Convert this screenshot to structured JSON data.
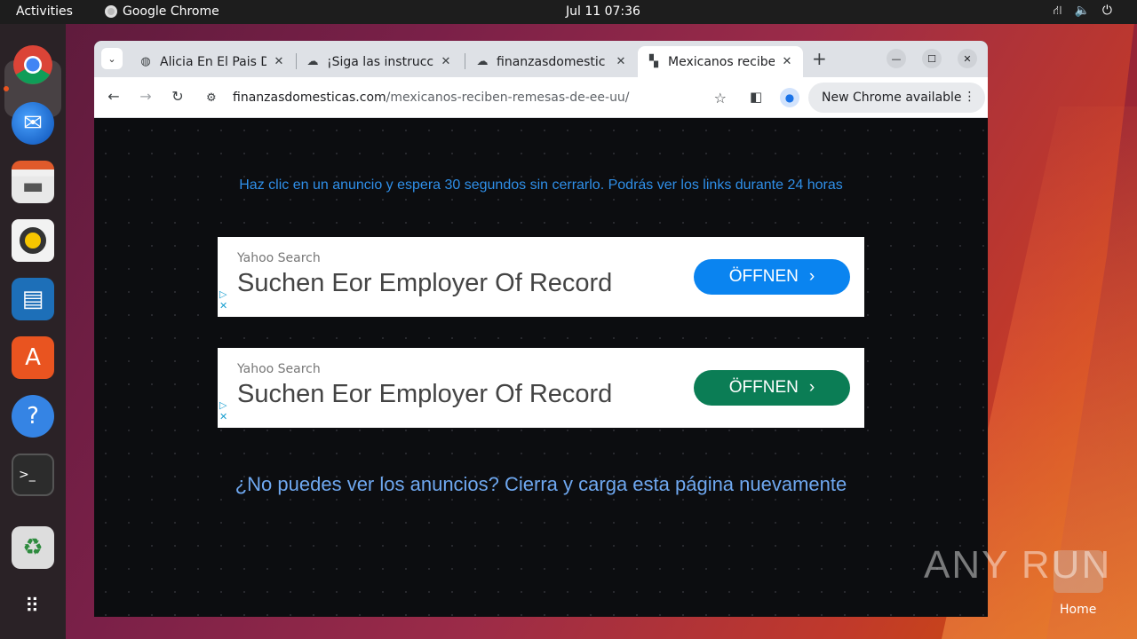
{
  "topbar": {
    "activities": "Activities",
    "app_name": "Google Chrome",
    "clock": "Jul 11  07:36"
  },
  "dock": {
    "items": [
      "chrome-icon",
      "thunderbird-icon",
      "files-icon",
      "rhythmbox-icon",
      "writer-icon",
      "app-center-icon",
      "help-icon",
      "terminal-icon",
      "trash-icon",
      "app-grid-icon"
    ]
  },
  "browser": {
    "tabs": [
      {
        "title": "Alicia En El Pais D",
        "favicon": "globe-icon"
      },
      {
        "title": "¡Siga las instrucci",
        "favicon": "download-cloud-icon"
      },
      {
        "title": "finanzasdomestic",
        "favicon": "download-cloud-icon"
      },
      {
        "title": "Mexicanos recibe",
        "favicon": "site-icon",
        "active": true
      }
    ],
    "url_domain": "finanzasdomesticas.com",
    "url_path": "/mexicanos-reciben-remesas-de-ee-uu/",
    "update_label": "New Chrome available"
  },
  "page": {
    "instructions": "Haz clic en un anuncio y espera 30 segundos sin cerrarlo. Podrás ver los links durante 24 horas",
    "ads": [
      {
        "brand": "Yahoo Search",
        "headline": "Suchen Eor Employer Of Record",
        "cta": "ÖFFNEN",
        "cta_color": "#0a84f0"
      },
      {
        "brand": "Yahoo Search",
        "headline": "Suchen Eor Employer Of Record",
        "cta": "ÖFFNEN",
        "cta_color": "#0b7d55"
      }
    ],
    "reload_note": "¿No puedes ver los anuncios? Cierra y carga esta página nuevamente"
  },
  "desktop": {
    "watermark": "ANY RUN",
    "home_label": "Home"
  }
}
